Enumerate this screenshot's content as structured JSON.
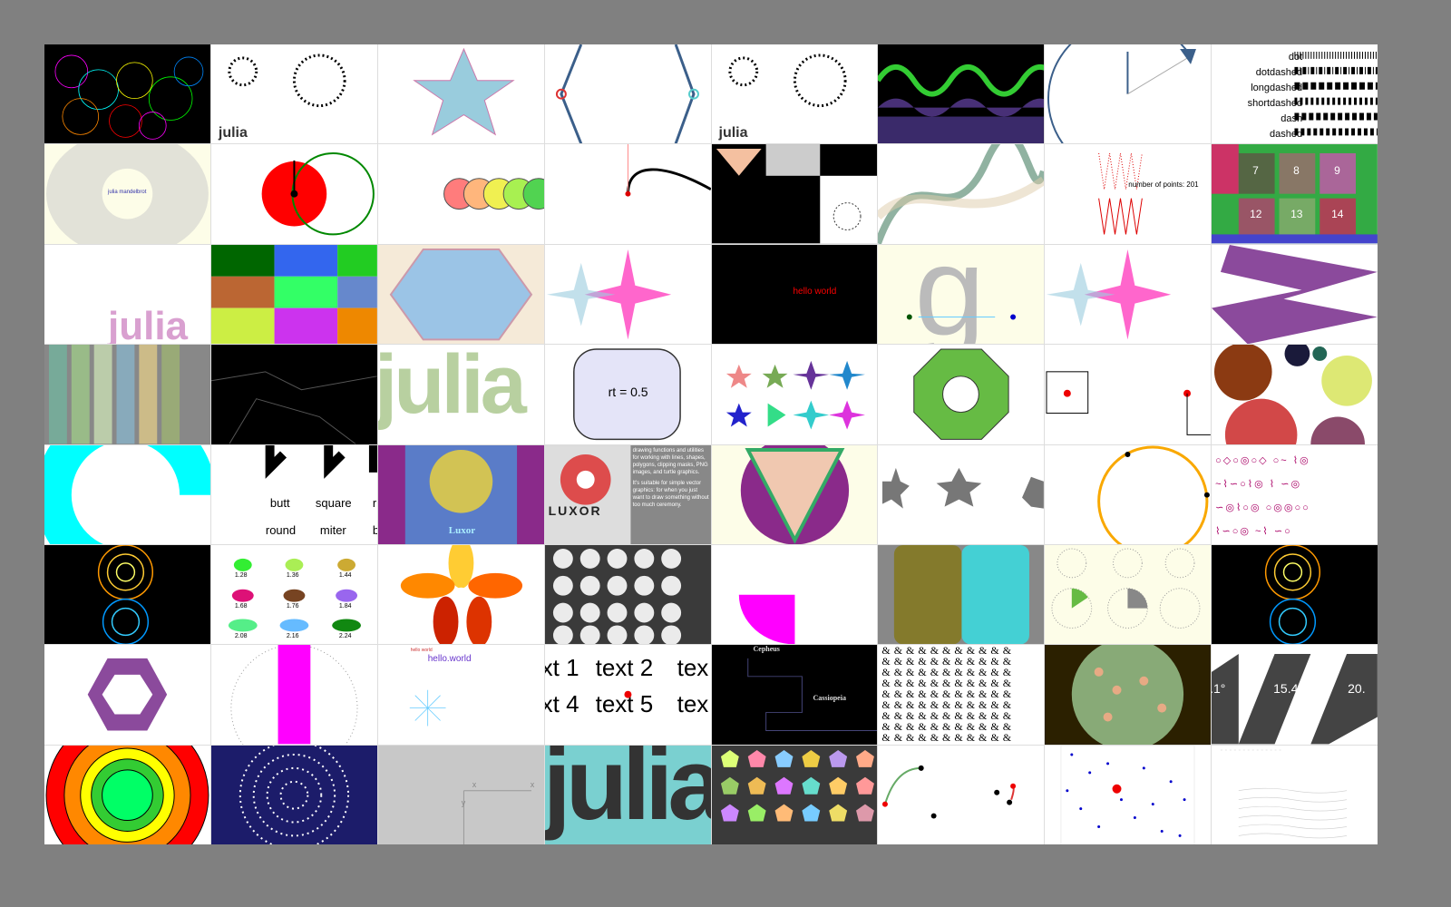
{
  "logo_text": "julia",
  "cells": {
    "dashes": [
      "dot",
      "dotdashed",
      "longdashed",
      "shortdashed",
      "dash",
      "dashed"
    ],
    "mandel_label": "julia mandelbrot",
    "points_label": "number of points: 201",
    "hello_world": "hello world",
    "rt_label": "rt = 0.5",
    "caps": [
      "butt",
      "square",
      "r"
    ],
    "joins": [
      "round",
      "miter",
      "b"
    ],
    "luxor_blue": "Luxor",
    "luxor_logo": "LUXOR",
    "luxor_desc": "drawing functions and utilities for working with lines, shapes, polygons, clipping masks, PNG images, and turtle graphics.",
    "luxor_desc2": "It's suitable for simple vector graphics: for when you just want to draw something without too much ceremony.",
    "ellipse_values": [
      "1.28",
      "1.36",
      "1.44",
      "1.68",
      "1.76",
      "1.84",
      "2.08",
      "2.16",
      "2.24"
    ],
    "hello_dot_world": "hello.world",
    "text_row1": [
      "xt 1",
      "text 2",
      "tex"
    ],
    "text_row2": [
      "xt 4",
      "text 5",
      "tex"
    ],
    "star_names": [
      "Cepheus",
      "Cassiopeia"
    ],
    "angles": [
      ".1°",
      "15.4°",
      "20."
    ],
    "tile_numbers": [
      "7",
      "8",
      "9",
      "12",
      "13",
      "14"
    ],
    "axis_x": "x",
    "axis_y": "y"
  }
}
